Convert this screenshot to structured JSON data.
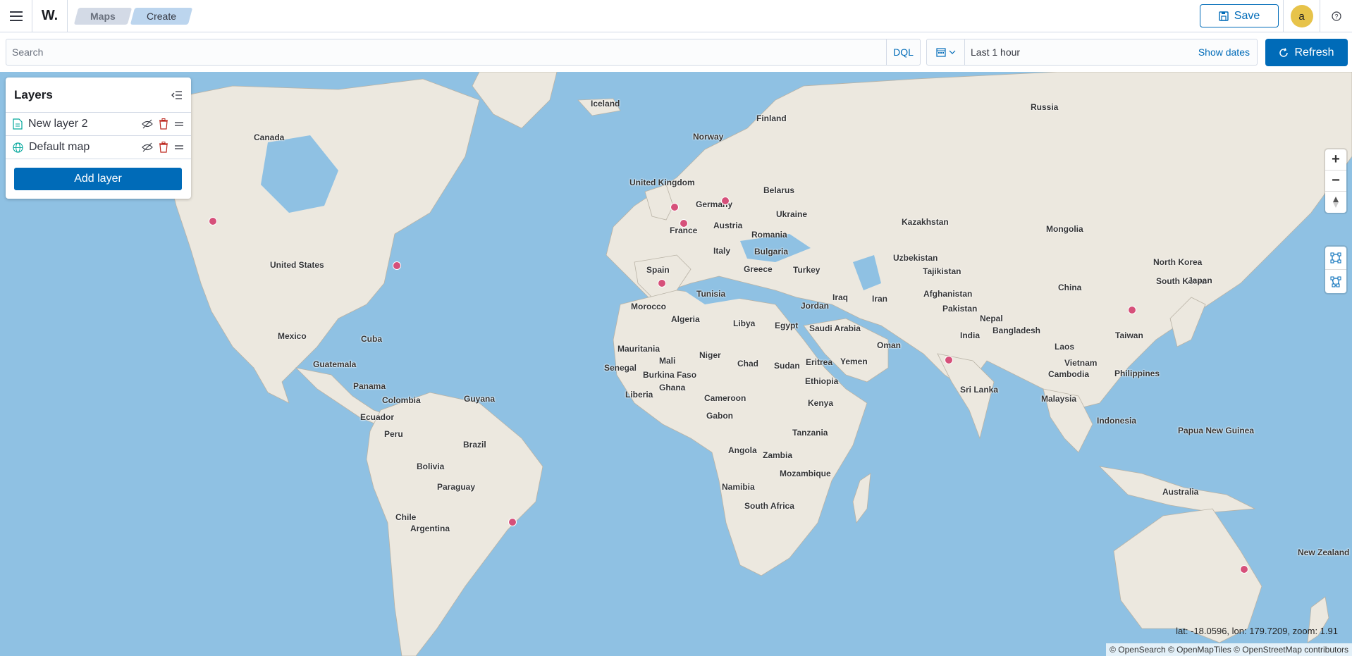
{
  "header": {
    "logo_text": "W.",
    "breadcrumbs": [
      "Maps",
      "Create"
    ],
    "save_label": "Save",
    "avatar_initial": "a"
  },
  "query": {
    "search_placeholder": "Search",
    "language": "DQL",
    "date_range": "Last 1 hour",
    "show_dates": "Show dates",
    "refresh_label": "Refresh"
  },
  "layers_panel": {
    "title": "Layers",
    "items": [
      {
        "name": "New layer 2",
        "icon": "document-icon"
      },
      {
        "name": "Default map",
        "icon": "globe-icon"
      }
    ],
    "add_label": "Add layer"
  },
  "map": {
    "labels": [
      "Iceland",
      "Russia",
      "Finland",
      "Norway",
      "Canada",
      "United Kingdom",
      "Belarus",
      "Germany",
      "Ukraine",
      "Kazakhstan",
      "Mongolia",
      "Austria",
      "Romania",
      "France",
      "Bulgaria",
      "Italy",
      "Uzbekistan",
      "Tajikistan",
      "United States",
      "Spain",
      "Greece",
      "Turkey",
      "North Korea",
      "South Korea",
      "Japan",
      "Tunisia",
      "Afghanistan",
      "China",
      "Iraq",
      "Iran",
      "Jordan",
      "Pakistan",
      "Morocco",
      "Algeria",
      "Libya",
      "Egypt",
      "Saudi Arabia",
      "Nepal",
      "Mexico",
      "Cuba",
      "India",
      "Bangladesh",
      "Taiwan",
      "Oman",
      "Mauritania",
      "Laos",
      "Guatemala",
      "Niger",
      "Mali",
      "Chad",
      "Sudan",
      "Eritrea",
      "Yemen",
      "Vietnam",
      "Senegal",
      "Burkina Faso",
      "Cambodia",
      "Philippines",
      "Ethiopia",
      "Ghana",
      "Liberia",
      "Sri Lanka",
      "Panama",
      "Guyana",
      "Colombia",
      "Cameroon",
      "Malaysia",
      "Kenya",
      "Ecuador",
      "Gabon",
      "Indonesia",
      "Papua New Guinea",
      "Peru",
      "Tanzania",
      "Brazil",
      "Angola",
      "Bolivia",
      "Zambia",
      "Paraguay",
      "Mozambique",
      "Namibia",
      "Australia",
      "South Africa",
      "Chile",
      "Argentina",
      "New Zealand"
    ],
    "coordinates_readout": "lat: -18.0596, lon: 179.7209, zoom: 1.91",
    "attribution": "© OpenSearch © OpenMapTiles © OpenStreetMap contributors",
    "point_color": "#d6507a",
    "water_color": "#8fc1e3",
    "land_color": "#ece8df"
  },
  "colors": {
    "primary": "#006bb8",
    "avatar": "#e7c34a"
  }
}
